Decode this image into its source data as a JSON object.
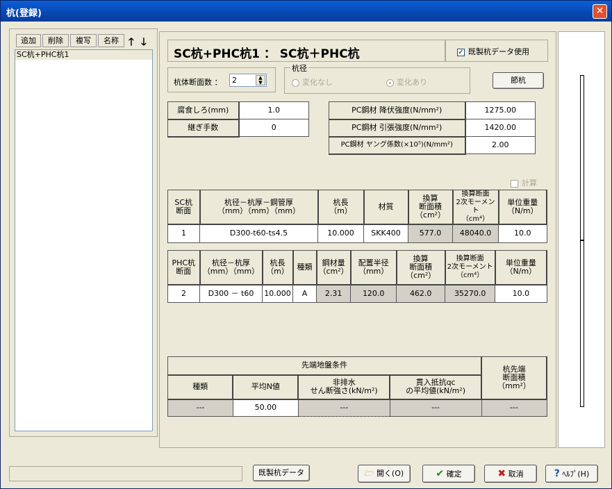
{
  "window": {
    "title": "杭(登録)"
  },
  "list": {
    "buttons": [
      "追加",
      "削除",
      "複写",
      "名称"
    ],
    "items": [
      "SC杭+PHC杭1"
    ]
  },
  "header": {
    "title": "SC杭+PHC杭1 ： SC杭＋PHC杭",
    "prefab_label": "既製杭データ使用"
  },
  "section_count": {
    "label": "杭体断面数 ：",
    "value": "2"
  },
  "diameter_group": {
    "title": "杭径",
    "opt1": "変化なし",
    "opt2": "変化あり"
  },
  "joint_button": "節杭",
  "corrosion": {
    "label": "腐食しろ(mm)",
    "value": "1.0"
  },
  "joints": {
    "label": "継ぎ手数",
    "value": "0"
  },
  "pc_steel": [
    {
      "label": "PC鋼材 降伏強度(N/mm²)",
      "value": "1275.00"
    },
    {
      "label": "PC鋼材 引張強度(N/mm²)",
      "value": "1420.00"
    },
    {
      "label": "PC鋼材 ヤング係数(×10⁵)(N/mm²)",
      "value": "2.00"
    }
  ],
  "calc_label": "計算",
  "sc_table": {
    "headers": [
      "SC杭\n断面",
      "杭径－杭厚－鋼管厚\n（mm）（mm）（mm）",
      "杭長\n（m）",
      "材質",
      "換算\n断面積\n（cm²）",
      "換算断面\n2次モーメント\n（cm⁴）",
      "単位重量\n（N/m）"
    ],
    "row": [
      "1",
      "D300-t60-ts4.5",
      "10.000",
      "SKK400",
      "577.0",
      "48040.0",
      "10.0"
    ]
  },
  "phc_table": {
    "headers": [
      "PHC杭\n断面",
      "杭径－杭厚\n（mm）（mm）",
      "杭長\n（m）",
      "種類",
      "鋼材量\n（cm²）",
      "配置半径\n（mm）",
      "換算\n断面積\n（cm²）",
      "換算断面\n2次モーメント\n（cm⁴）",
      "単位重量\n（N/m）"
    ],
    "row": [
      "2",
      "D300 － t60",
      "10.000",
      "A",
      "2.31",
      "120.0",
      "462.0",
      "35270.0",
      "10.0"
    ]
  },
  "ground_table": {
    "title": "先端地盤条件",
    "tip_area": "杭先端\n断面積\n（mm²）",
    "headers": [
      "種類",
      "平均N値",
      "非排水\nせん断強さ(kN/m²)",
      "貫入抵抗qc\nの平均値(kN/m²)"
    ],
    "row": [
      "---",
      "50.00",
      "---",
      "---",
      "---"
    ]
  },
  "footer": {
    "prefab": "既製杭データ",
    "open": "開く(O)",
    "ok": "確定",
    "cancel": "取消",
    "help": "ﾍﾙﾌﾟ(H)"
  }
}
